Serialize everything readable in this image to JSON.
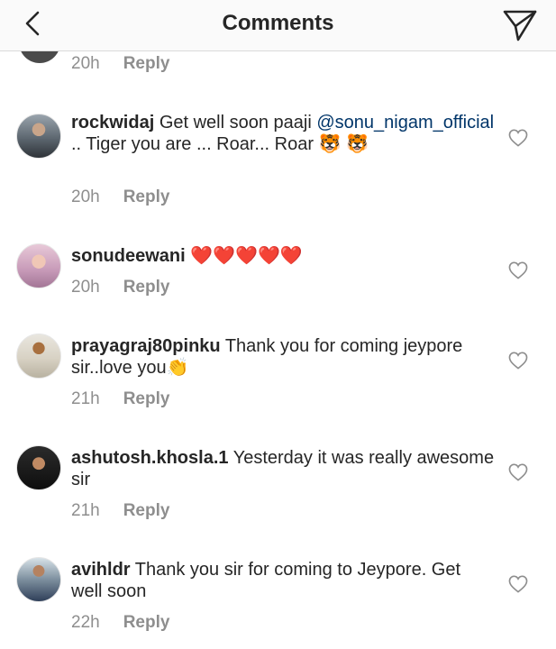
{
  "header": {
    "title": "Comments"
  },
  "partial": {
    "time": "20h",
    "reply": "Reply"
  },
  "comments": [
    {
      "username": "rockwidaj",
      "text_before": " Get well soon paaji ",
      "mention": "@sonu_nigam_official",
      "text_after": " .. Tiger you are ... Roar... Roar 🐯 🐯",
      "time": "20h",
      "reply": "Reply"
    },
    {
      "username": "sonudeewani",
      "text": " ❤️❤️❤️❤️❤️",
      "time": "20h",
      "reply": "Reply"
    },
    {
      "username": "prayagraj80pinku",
      "text": " Thank you for coming jeypore sir..love you👏",
      "time": "21h",
      "reply": "Reply"
    },
    {
      "username": "ashutosh.khosla.1",
      "text": " Yesterday it was really awesome sir",
      "time": "21h",
      "reply": "Reply"
    },
    {
      "username": "avihldr",
      "text": " Thank you sir for coming to Jeypore. Get well soon",
      "time": "22h",
      "reply": "Reply"
    }
  ],
  "colors": {
    "header_bg": "#fafafa",
    "text": "#262626",
    "meta": "#8e8e8e",
    "mention": "#003569"
  },
  "icons": {
    "back": "chevron-left-icon",
    "send": "paper-plane-icon",
    "like": "heart-outline-icon"
  }
}
